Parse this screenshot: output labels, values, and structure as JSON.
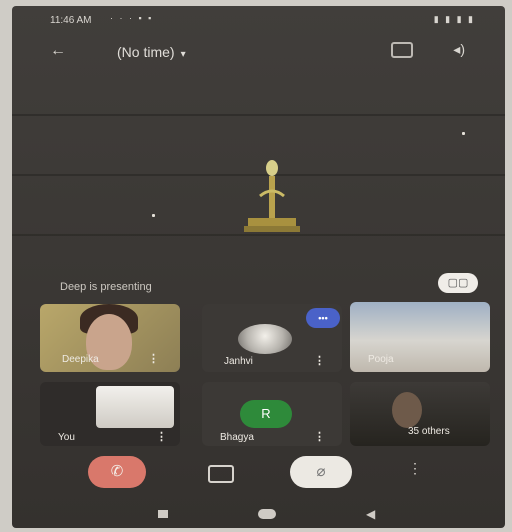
{
  "status_bar": {
    "time": "11:46 AM",
    "icons_left": "· · ·  ▪ ▪",
    "icons_right": "▮ ▮ ▮ ▮"
  },
  "header": {
    "back_icon": "arrow-left-icon",
    "title": "(No time)",
    "title_caret": "▾",
    "camera_switch_icon": "camera-switch-icon",
    "speaker_icon": "speaker-icon",
    "speaker_glyph": "◂)"
  },
  "presenting": {
    "text": "Deep is presenting"
  },
  "layout_button": {
    "icon": "grid-icon",
    "glyph": "▢▢"
  },
  "participants": [
    {
      "name": "Deepika",
      "more": "⋮"
    },
    {
      "name": "Janhvi",
      "more": "⋮",
      "badge": "•••"
    },
    {
      "name": "Pooja"
    },
    {
      "name": "You",
      "more": "⋮"
    },
    {
      "name": "Bhagya",
      "initial": "R",
      "more": "⋮"
    },
    {
      "name": "35 others"
    }
  ],
  "controls": {
    "end_call_glyph": "✆",
    "mic_glyph": "⌀",
    "more_glyph": "⋮"
  },
  "nav": {
    "back_glyph": "◀"
  },
  "colors": {
    "end_call": "#d9786b",
    "badge": "#4a62c8",
    "avatar_green": "#2e8a3a"
  }
}
